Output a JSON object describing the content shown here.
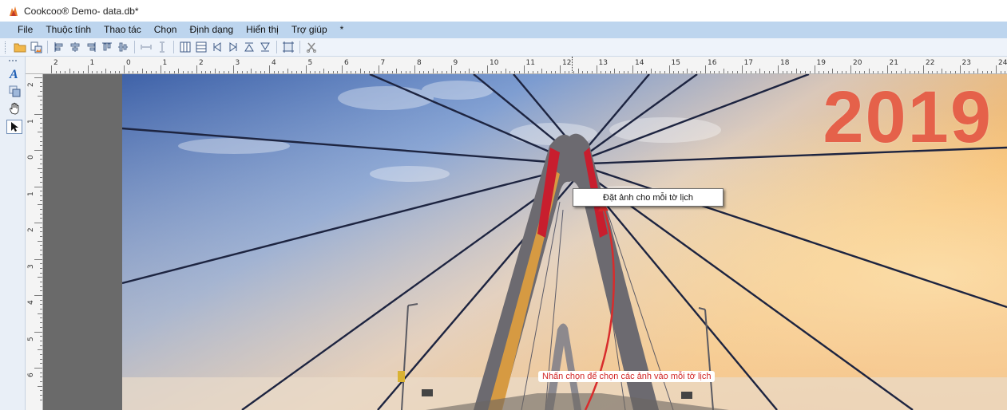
{
  "window": {
    "title": "Cookcoo® Demo- data.db*"
  },
  "menu": {
    "items": [
      "File",
      "Thuộc tính",
      "Thao tác",
      "Chọn",
      "Định dạng",
      "Hiển thị",
      "Trợ giúp",
      "*"
    ]
  },
  "toolbar": {
    "buttons": [
      "open-folder-icon",
      "add-photo-icon",
      "align-left-icon",
      "align-center-icon",
      "align-right-icon",
      "align-top-icon",
      "align-middle-icon",
      "space-horizontal-icon",
      "space-vertical-icon",
      "column-layout-icon",
      "row-layout-icon",
      "first-page-icon",
      "last-page-icon",
      "top-icon",
      "bottom-icon",
      "crop-icon",
      "cut-icon"
    ]
  },
  "tools": {
    "items": [
      "text-tool-icon",
      "shape-tool-icon",
      "hand-tool-icon",
      "pointer-tool-icon"
    ],
    "active": "pointer-tool-icon"
  },
  "ruler": {
    "horizontal_labels": [
      "2",
      "1",
      "0",
      "1",
      "2",
      "3",
      "4",
      "5",
      "6",
      "7",
      "8",
      "9",
      "10",
      "11",
      "12",
      "13",
      "14",
      "15",
      "16",
      "17",
      "18",
      "19",
      "20",
      "21",
      "22",
      "23",
      "24"
    ],
    "vertical_labels": [
      "2",
      "1",
      "0",
      "1",
      "2",
      "3",
      "4",
      "5",
      "6"
    ]
  },
  "canvas": {
    "year": "2019",
    "year_color": "#e5614a",
    "tooltip": "Đặt ảnh cho mỗi tờ lịch",
    "note": "Nhấn chọn để chọn các ảnh vào mỗi tờ lịch",
    "arrow_color": "#d82c2c"
  }
}
